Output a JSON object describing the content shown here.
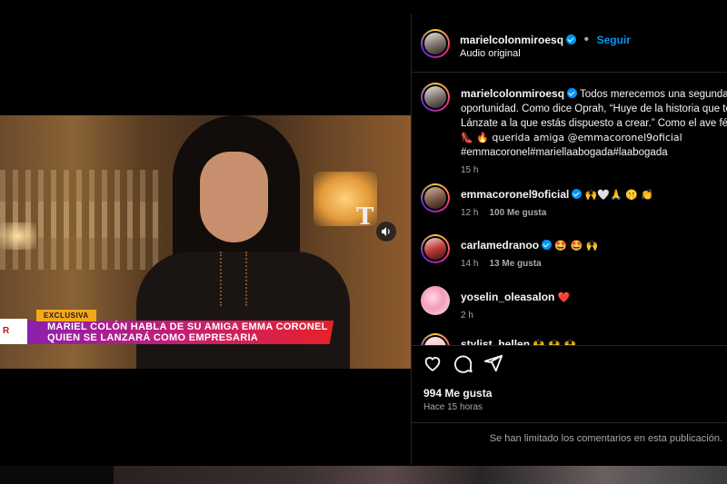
{
  "video": {
    "tag": "EXCLUSIVA",
    "headline_line1": "MARIEL COLÓN HABLA DE SU AMIGA EMMA CORONEL",
    "headline_line2": "QUIEN SE LANZARÁ COMO EMPRESARIA",
    "channel_logo": "T",
    "left_logo": "R"
  },
  "post": {
    "username": "marielcolonmiroesq",
    "follow_label": "Seguir",
    "audio": "Audio original",
    "caption": {
      "username": "marielcolonmiroesq",
      "lines": [
        "Todos merecemos una segunda",
        "oportunidad. Como dice Oprah, “Huye de la historia que te",
        "Lánzate a la que estás dispuesto a crear.” Como el ave fén",
        "👠 🔥 querida amiga @emmacoronel9oficial",
        "#emmacoronel#mariellaabogada#laabogada"
      ],
      "age": "15 h"
    },
    "comments": [
      {
        "username": "emmacoronel9oficial",
        "verified": true,
        "text": "🙌🤍🙏 🤫 👏",
        "age": "12 h",
        "likes": "100 Me gusta"
      },
      {
        "username": "carlamedranoo",
        "verified": true,
        "text": "🤩 🤩 🙌",
        "age": "14 h",
        "likes": "13 Me gusta"
      },
      {
        "username": "yoselin_oleasalon",
        "verified": false,
        "text": "❤️",
        "age": "2 h",
        "likes": ""
      },
      {
        "username": "stylist_hellen",
        "verified": false,
        "text": "🙌 🙌 🙌",
        "age": "",
        "likes": ""
      }
    ],
    "likes": "994 Me gusta",
    "timestamp": "Hace 15 horas",
    "limited_notice": "Se han limitado los comentarios en esta publicación."
  },
  "colors": {
    "accent": "#0095f6",
    "text_secondary": "#a8a8a8",
    "divider": "#262626"
  },
  "icons": [
    "heart-icon",
    "comment-icon",
    "share-icon",
    "volume-icon",
    "verified-badge-icon"
  ]
}
